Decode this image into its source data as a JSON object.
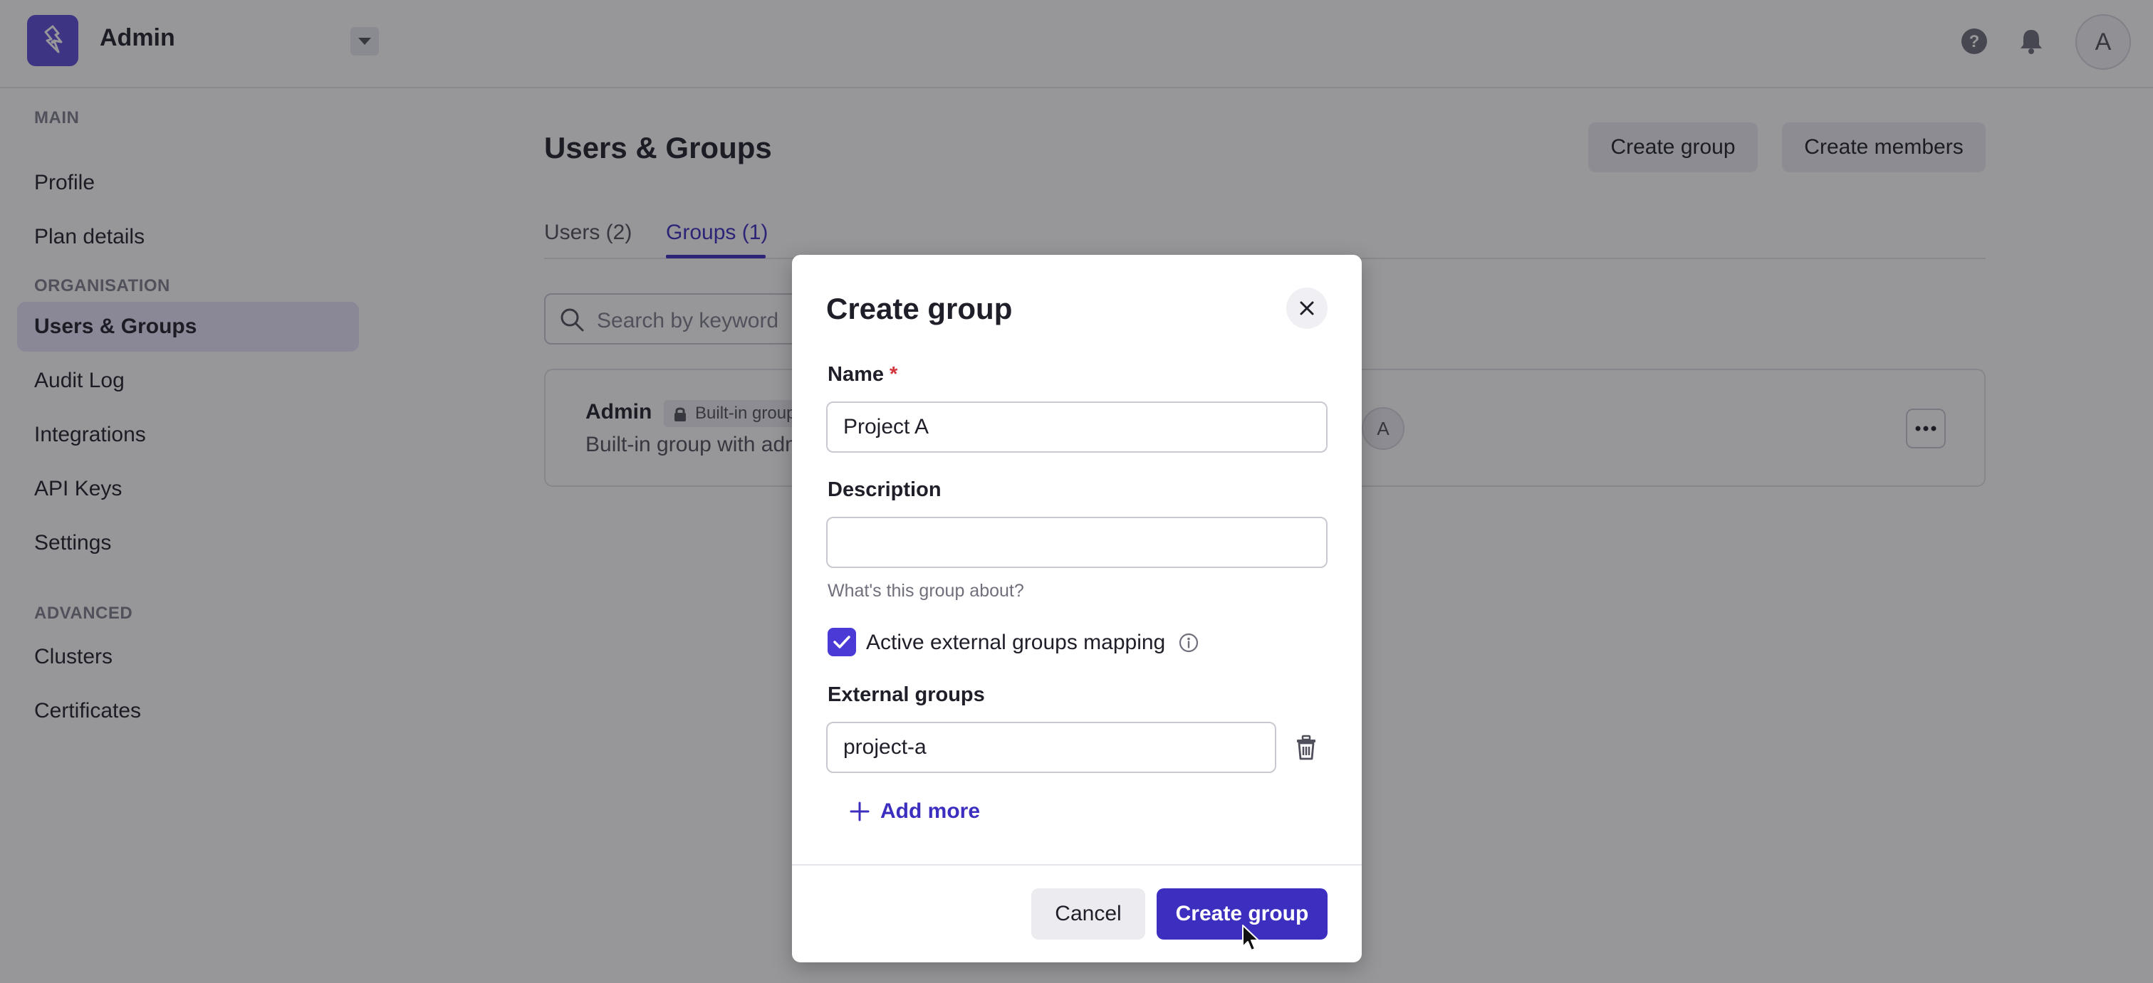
{
  "header": {
    "org_name": "Admin",
    "avatar_initial": "A"
  },
  "sidebar": {
    "sections": [
      {
        "label": "MAIN",
        "items": [
          "Profile",
          "Plan details"
        ]
      },
      {
        "label": "ORGANISATION",
        "items": [
          "Users & Groups",
          "Audit Log",
          "Integrations",
          "API Keys",
          "Settings"
        ]
      },
      {
        "label": "ADVANCED",
        "items": [
          "Clusters",
          "Certificates"
        ]
      }
    ],
    "active_item": "Users & Groups"
  },
  "main": {
    "title": "Users & Groups",
    "create_group_label": "Create group",
    "create_members_label": "Create members",
    "tabs": [
      {
        "label": "Users (2)",
        "active": false
      },
      {
        "label": "Groups (1)",
        "active": true
      }
    ],
    "search_placeholder": "Search by keyword",
    "group": {
      "name": "Admin",
      "badge": "Built-in group",
      "description": "Built-in group with admin",
      "member_initial": "A"
    }
  },
  "modal": {
    "title": "Create group",
    "name_label": "Name",
    "required_marker": "*",
    "name_value": "Project A",
    "description_label": "Description",
    "description_value": "",
    "description_hint": "What's this group about?",
    "mapping_label": "Active external groups mapping",
    "mapping_checked": true,
    "external_groups_label": "External groups",
    "external_groups": [
      "project-a"
    ],
    "add_more_label": "Add more",
    "cancel_label": "Cancel",
    "submit_label": "Create group"
  },
  "colors": {
    "accent": "#3c2fbf",
    "logo": "#5b4bd6",
    "active_nav": "#e7e4f8",
    "required": "#d4343c"
  }
}
